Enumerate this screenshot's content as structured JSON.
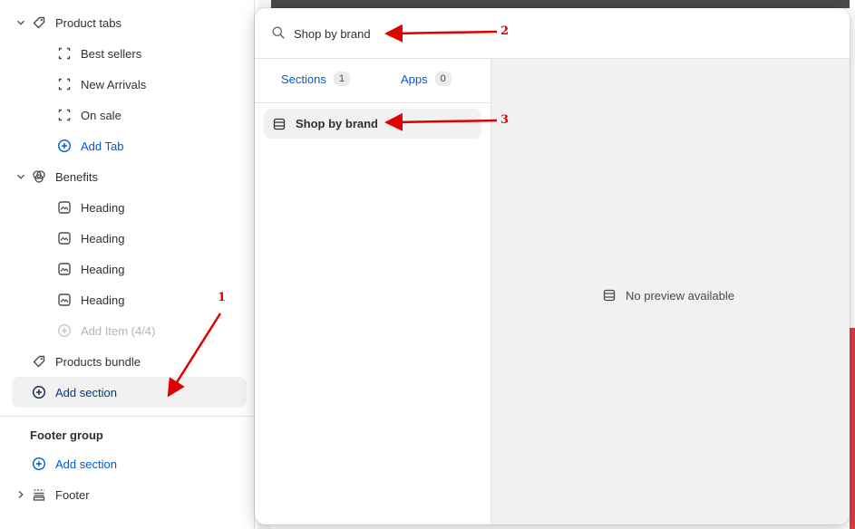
{
  "sidebar": {
    "items": [
      {
        "label": "Product tabs",
        "icon": "tag-icon"
      },
      {
        "label": "Best sellers",
        "icon": "block-icon"
      },
      {
        "label": "New Arrivals",
        "icon": "block-icon"
      },
      {
        "label": "On sale",
        "icon": "block-icon"
      },
      {
        "label": "Add Tab",
        "icon": "plus-circle-icon"
      },
      {
        "label": "Benefits",
        "icon": "blocks-icon"
      },
      {
        "label": "Heading",
        "icon": "image-icon"
      },
      {
        "label": "Heading",
        "icon": "image-icon"
      },
      {
        "label": "Heading",
        "icon": "image-icon"
      },
      {
        "label": "Heading",
        "icon": "image-icon"
      },
      {
        "label": "Add Item (4/4)",
        "icon": "plus-circle-icon"
      },
      {
        "label": "Products bundle",
        "icon": "tag-icon"
      },
      {
        "label": "Add section",
        "icon": "plus-circle-icon"
      }
    ],
    "footer_group": {
      "title": "Footer group",
      "add_section": "Add section",
      "footer": "Footer"
    }
  },
  "popup": {
    "search": {
      "value": "Shop by brand"
    },
    "tabs": [
      {
        "label": "Sections",
        "count": "1"
      },
      {
        "label": "Apps",
        "count": "0"
      }
    ],
    "result": {
      "label": "Shop by brand"
    },
    "preview": {
      "message": "No preview available"
    }
  },
  "annotations": {
    "labels": [
      "1",
      "2",
      "3"
    ],
    "color": "#e00000"
  },
  "colors": {
    "accent": "#005bd3",
    "highlight": "#f1f1f1"
  }
}
